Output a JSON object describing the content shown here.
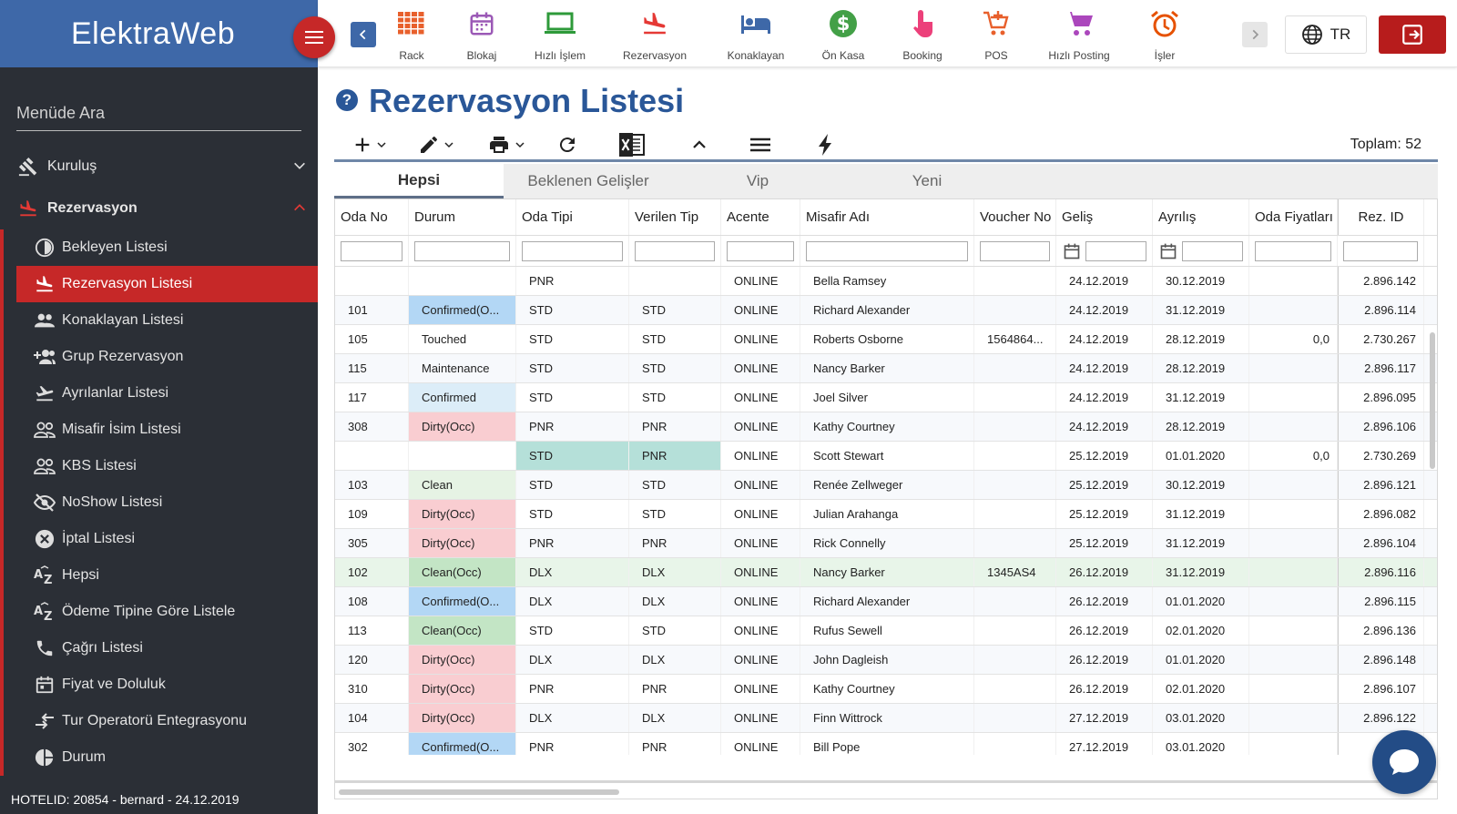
{
  "app": {
    "brand": "ElektraWeb"
  },
  "sidebar": {
    "search_placeholder": "Menüde Ara",
    "top_items": [
      {
        "label": "Kuruluş",
        "icon": "gavel-icon"
      },
      {
        "label": "Rezervasyon",
        "icon": "flight-land-icon"
      }
    ],
    "sub_items": [
      {
        "label": "Bekleyen Listesi",
        "icon": "clock-icon"
      },
      {
        "label": "Rezervasyon Listesi",
        "icon": "flight-land-icon"
      },
      {
        "label": "Konaklayan Listesi",
        "icon": "people-icon"
      },
      {
        "label": "Grup Rezervasyon",
        "icon": "group-add-icon"
      },
      {
        "label": "Ayrılanlar Listesi",
        "icon": "flight-takeoff-icon"
      },
      {
        "label": "Misafir İsim Listesi",
        "icon": "people-outline-icon"
      },
      {
        "label": "KBS Listesi",
        "icon": "people-outline-icon"
      },
      {
        "label": "NoShow Listesi",
        "icon": "eye-off-icon"
      },
      {
        "label": "İptal Listesi",
        "icon": "cancel-icon"
      },
      {
        "label": "Hepsi",
        "icon": "sort-az-icon"
      },
      {
        "label": "Ödeme Tipine Göre Listele",
        "icon": "sort-az-icon"
      },
      {
        "label": "Çağrı Listesi",
        "icon": "phone-icon"
      },
      {
        "label": "Fiyat ve Doluluk",
        "icon": "calendar-icon"
      },
      {
        "label": "Tur Operatorü Entegrasyonu",
        "icon": "swap-icon"
      },
      {
        "label": "Durum",
        "icon": "pie-chart-icon"
      }
    ],
    "status": "HOTELID: 20854 - bernard - 24.12.2019"
  },
  "toolbar": {
    "items": [
      {
        "label": "Rack",
        "icon": "grid-icon",
        "color": "#e8602c"
      },
      {
        "label": "Blokaj",
        "icon": "calendar-icon",
        "color": "#9b59b6"
      },
      {
        "label": "Hızlı İşlem",
        "icon": "laptop-icon",
        "color": "#2e9a3a"
      },
      {
        "label": "Rezervasyon",
        "icon": "flight-land-icon",
        "color": "#e53935"
      },
      {
        "label": "Konaklayan",
        "icon": "bed-icon",
        "color": "#3e68a8"
      },
      {
        "label": "Ön Kasa",
        "icon": "dollar-icon",
        "color": "#43a047"
      },
      {
        "label": "Booking",
        "icon": "touch-icon",
        "color": "#ec407a"
      },
      {
        "label": "POS",
        "icon": "cart-add-icon",
        "color": "#e8602c"
      },
      {
        "label": "Hızlı Posting",
        "icon": "cart-icon",
        "color": "#ab47bc"
      },
      {
        "label": "İşler",
        "icon": "alarm-icon",
        "color": "#e65100"
      }
    ],
    "language": "TR"
  },
  "page": {
    "title": "Rezervasyon Listesi",
    "total": "Toplam: 52",
    "tabs": [
      "Hepsi",
      "Beklenen Gelişler",
      "Vip",
      "Yeni"
    ],
    "columns": [
      "Oda No",
      "Durum",
      "Oda Tipi",
      "Verilen Tip",
      "Acente",
      "Misafir Adı",
      "Voucher No",
      "Geliş",
      "Ayrılış",
      "Oda Fiyatları",
      "Rez. ID"
    ],
    "rows": [
      {
        "oda": "",
        "durum": "",
        "status": "",
        "tip": "PNR",
        "verilen": "",
        "acente": "ONLINE",
        "misafir": "Bella Ramsey",
        "voucher": "",
        "gelis": "24.12.2019",
        "ayrilis": "30.12.2019",
        "fiyat": "",
        "rez": "2.896.142"
      },
      {
        "oda": "101",
        "durum": "Confirmed(O...",
        "status": "confo",
        "tip": "STD",
        "verilen": "STD",
        "acente": "ONLINE",
        "misafir": "Richard Alexander",
        "voucher": "",
        "gelis": "24.12.2019",
        "ayrilis": "31.12.2019",
        "fiyat": "",
        "rez": "2.896.114"
      },
      {
        "oda": "105",
        "durum": "Touched",
        "status": "",
        "tip": "STD",
        "verilen": "STD",
        "acente": "ONLINE",
        "misafir": "Roberts Osborne",
        "voucher": "1564864...",
        "gelis": "24.12.2019",
        "ayrilis": "28.12.2019",
        "fiyat": "0,0",
        "rez": "2.730.267"
      },
      {
        "oda": "115",
        "durum": "Maintenance",
        "status": "",
        "tip": "STD",
        "verilen": "STD",
        "acente": "ONLINE",
        "misafir": "Nancy Barker",
        "voucher": "",
        "gelis": "24.12.2019",
        "ayrilis": "28.12.2019",
        "fiyat": "",
        "rez": "2.896.117"
      },
      {
        "oda": "117",
        "durum": "Confirmed",
        "status": "conf",
        "tip": "STD",
        "verilen": "STD",
        "acente": "ONLINE",
        "misafir": "Joel Silver",
        "voucher": "",
        "gelis": "24.12.2019",
        "ayrilis": "31.12.2019",
        "fiyat": "",
        "rez": "2.896.095"
      },
      {
        "oda": "308",
        "durum": "Dirty(Occ)",
        "status": "dirty",
        "tip": "PNR",
        "verilen": "PNR",
        "acente": "ONLINE",
        "misafir": "Kathy Courtney",
        "voucher": "",
        "gelis": "24.12.2019",
        "ayrilis": "28.12.2019",
        "fiyat": "",
        "rez": "2.896.106"
      },
      {
        "oda": "",
        "durum": "",
        "status": "",
        "tip": "STD",
        "verilen": "PNR",
        "acente": "ONLINE",
        "misafir": "Scott Stewart",
        "voucher": "",
        "gelis": "25.12.2019",
        "ayrilis": "01.01.2020",
        "fiyat": "0,0",
        "rez": "2.730.269",
        "teal": true
      },
      {
        "oda": "103",
        "durum": "Clean",
        "status": "clean",
        "tip": "STD",
        "verilen": "STD",
        "acente": "ONLINE",
        "misafir": "Renée Zellweger",
        "voucher": "",
        "gelis": "25.12.2019",
        "ayrilis": "30.12.2019",
        "fiyat": "",
        "rez": "2.896.121"
      },
      {
        "oda": "109",
        "durum": "Dirty(Occ)",
        "status": "dirty",
        "tip": "STD",
        "verilen": "STD",
        "acente": "ONLINE",
        "misafir": "Julian Arahanga",
        "voucher": "",
        "gelis": "25.12.2019",
        "ayrilis": "31.12.2019",
        "fiyat": "",
        "rez": "2.896.082"
      },
      {
        "oda": "305",
        "durum": "Dirty(Occ)",
        "status": "dirty",
        "tip": "PNR",
        "verilen": "PNR",
        "acente": "ONLINE",
        "misafir": "Rick Connelly",
        "voucher": "",
        "gelis": "25.12.2019",
        "ayrilis": "31.12.2019",
        "fiyat": "",
        "rez": "2.896.104"
      },
      {
        "oda": "102",
        "durum": "Clean(Occ)",
        "status": "cleanocc",
        "tip": "DLX",
        "verilen": "DLX",
        "acente": "ONLINE",
        "misafir": "Nancy Barker",
        "voucher": "1345AS4",
        "gelis": "26.12.2019",
        "ayrilis": "31.12.2019",
        "fiyat": "",
        "rez": "2.896.116",
        "highlight": true
      },
      {
        "oda": "108",
        "durum": "Confirmed(O...",
        "status": "confo",
        "tip": "DLX",
        "verilen": "DLX",
        "acente": "ONLINE",
        "misafir": "Richard Alexander",
        "voucher": "",
        "gelis": "26.12.2019",
        "ayrilis": "01.01.2020",
        "fiyat": "",
        "rez": "2.896.115"
      },
      {
        "oda": "113",
        "durum": "Clean(Occ)",
        "status": "cleanocc",
        "tip": "STD",
        "verilen": "STD",
        "acente": "ONLINE",
        "misafir": "Rufus Sewell",
        "voucher": "",
        "gelis": "26.12.2019",
        "ayrilis": "02.01.2020",
        "fiyat": "",
        "rez": "2.896.136"
      },
      {
        "oda": "120",
        "durum": "Dirty(Occ)",
        "status": "dirty",
        "tip": "DLX",
        "verilen": "DLX",
        "acente": "ONLINE",
        "misafir": "John Dagleish",
        "voucher": "",
        "gelis": "26.12.2019",
        "ayrilis": "01.01.2020",
        "fiyat": "",
        "rez": "2.896.148"
      },
      {
        "oda": "310",
        "durum": "Dirty(Occ)",
        "status": "dirty",
        "tip": "PNR",
        "verilen": "PNR",
        "acente": "ONLINE",
        "misafir": "Kathy Courtney",
        "voucher": "",
        "gelis": "26.12.2019",
        "ayrilis": "02.01.2020",
        "fiyat": "",
        "rez": "2.896.107"
      },
      {
        "oda": "104",
        "durum": "Dirty(Occ)",
        "status": "dirty",
        "tip": "DLX",
        "verilen": "DLX",
        "acente": "ONLINE",
        "misafir": "Finn Wittrock",
        "voucher": "",
        "gelis": "27.12.2019",
        "ayrilis": "03.01.2020",
        "fiyat": "",
        "rez": "2.896.122"
      },
      {
        "oda": "302",
        "durum": "Confirmed(O...",
        "status": "confo",
        "tip": "PNR",
        "verilen": "PNR",
        "acente": "ONLINE",
        "misafir": "Bill Pope",
        "voucher": "",
        "gelis": "27.12.2019",
        "ayrilis": "03.01.2020",
        "fiyat": "",
        "rez": ""
      }
    ]
  }
}
